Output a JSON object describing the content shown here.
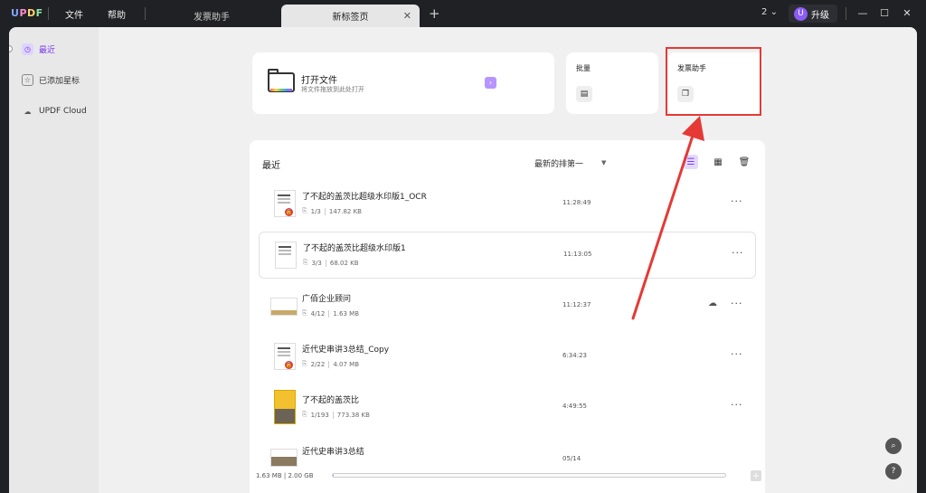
{
  "titlebar": {
    "logo": "UPDF",
    "menu": [
      "文件",
      "帮助"
    ],
    "tabs": [
      {
        "label": "发票助手",
        "active": false
      },
      {
        "label": "新标签页",
        "active": true
      }
    ],
    "tab_close": "✕",
    "new_tab": "+",
    "window_count": "2",
    "avatar_letter": "U",
    "upgrade_label": "升级"
  },
  "sidebar": {
    "items": [
      {
        "label": "最近",
        "icon": "clock-icon",
        "active": true
      },
      {
        "label": "已添加星标",
        "icon": "star-icon",
        "active": false
      },
      {
        "label": "UPDF Cloud",
        "icon": "cloud-icon",
        "active": false
      }
    ]
  },
  "open_file": {
    "title": "打开文件",
    "subtitle": "将文件拖放到此处打开",
    "arrow": "›"
  },
  "batch": {
    "title": "批量"
  },
  "invoice": {
    "title": "发票助手"
  },
  "recent": {
    "title": "最近",
    "sort_label": "最新的排第一",
    "files": [
      {
        "name": "了不起的盖茨比超级水印版1_OCR",
        "pages": "1/3",
        "size": "147.82 KB",
        "time": "11:28:49",
        "locked": true
      },
      {
        "name": "了不起的盖茨比超级水印版1",
        "pages": "3/3",
        "size": "68.02 KB",
        "time": "11:13:05",
        "locked": false
      },
      {
        "name": "广佰企业顾问",
        "pages": "4/12",
        "size": "1.63 MB",
        "time": "11:12:37",
        "locked": false,
        "cloud": true
      },
      {
        "name": "近代史串讲3总结_Copy",
        "pages": "2/22",
        "size": "4.07 MB",
        "time": "6:34:23",
        "locked": true
      },
      {
        "name": "了不起的盖茨比",
        "pages": "1/193",
        "size": "773.38 KB",
        "time": "4:49:55",
        "locked": false
      },
      {
        "name": "近代史串讲3总结",
        "pages": "",
        "size": "",
        "time": "05/14",
        "locked": false
      }
    ]
  },
  "storage": {
    "label": "1.63 MB | 2.00 GB",
    "used_fraction": 0.0008
  },
  "colors": {
    "accent": "#7c3aed",
    "highlight_red": "#e53935",
    "arrow_red": "#e53935"
  },
  "fabs": [
    {
      "icon": "search-icon",
      "glyph": "⌕"
    },
    {
      "icon": "help-icon",
      "glyph": "?"
    }
  ]
}
